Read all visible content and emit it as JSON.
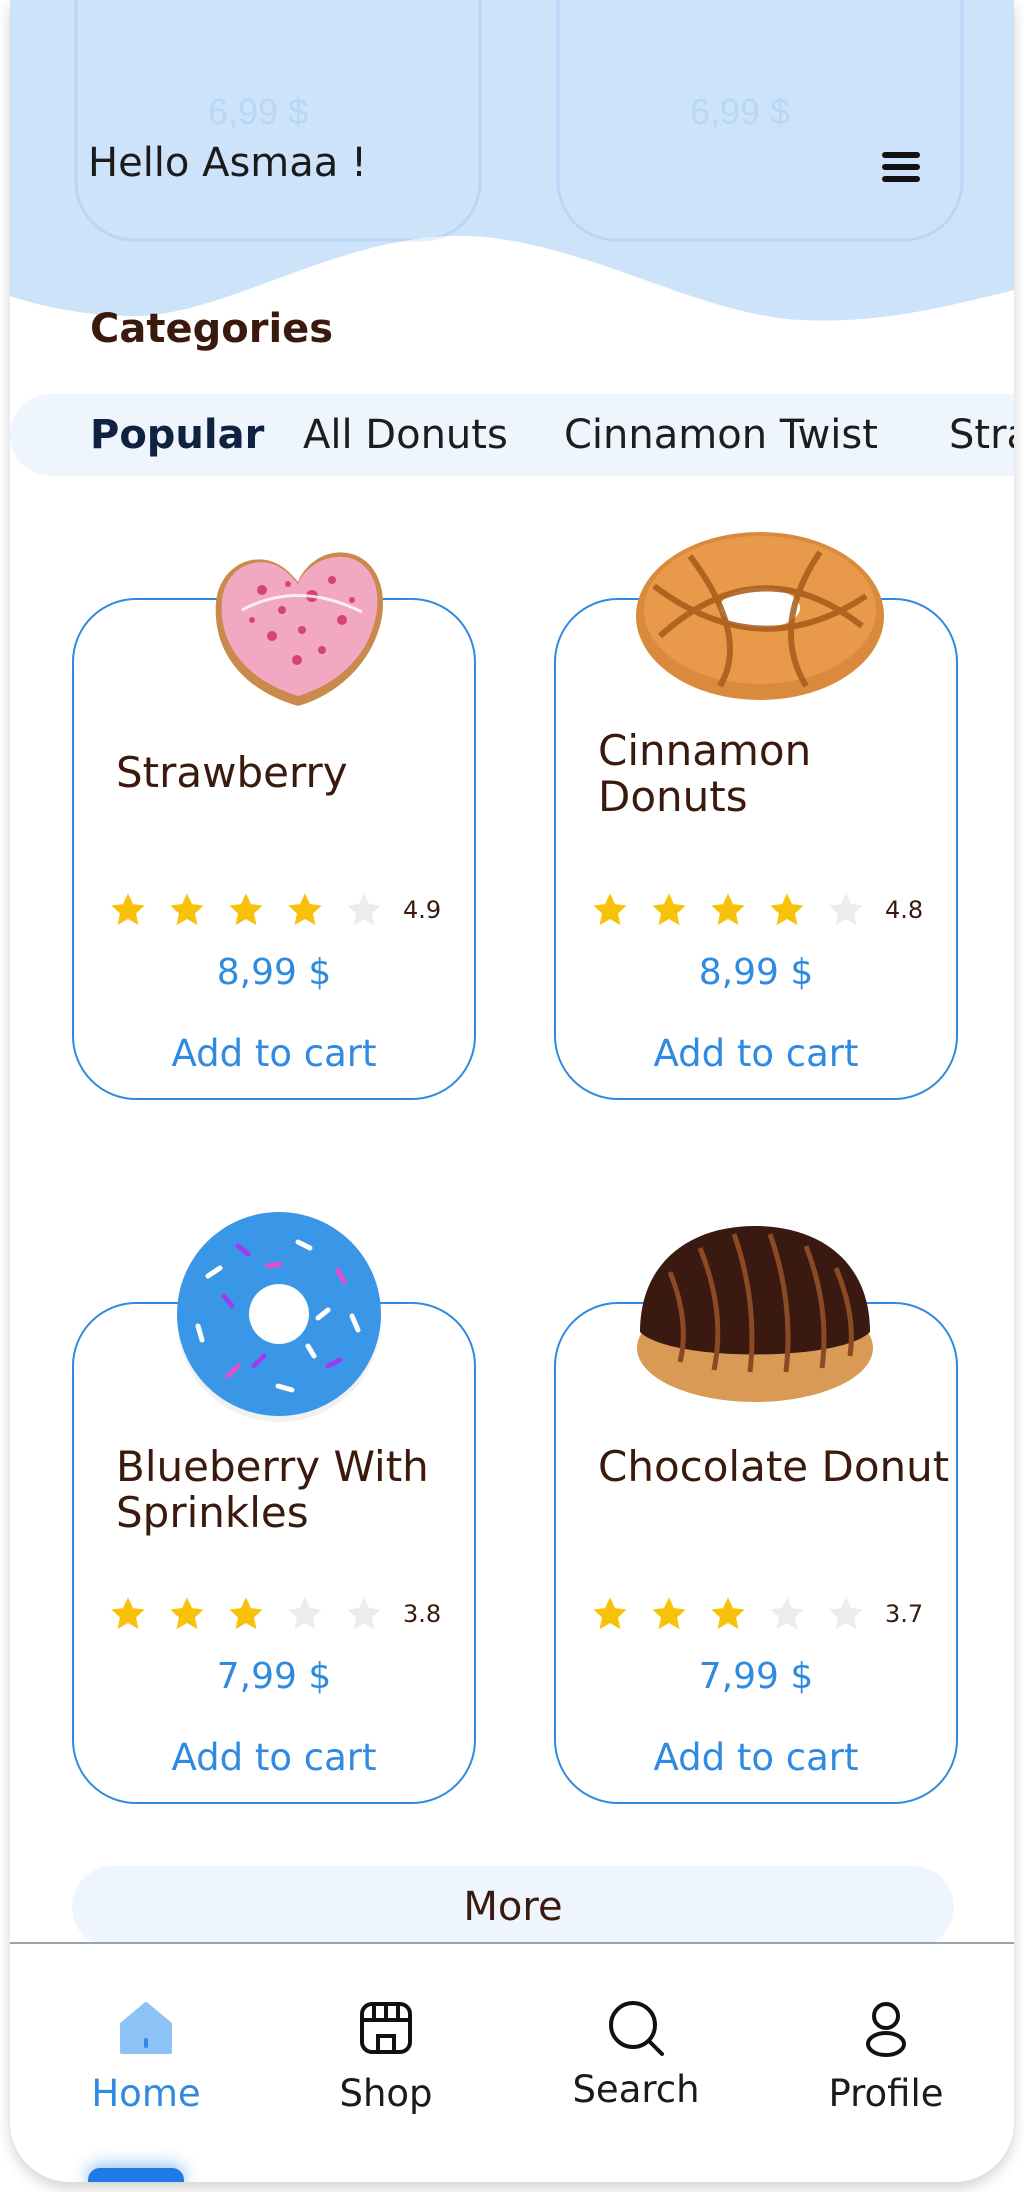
{
  "header": {
    "greeting": "Hello Asmaa !",
    "menu_icon": "hamburger-menu-icon",
    "background_color": "#cde3fa"
  },
  "categories": {
    "title": "Categories",
    "tabs": [
      {
        "label": "Popular",
        "active": true
      },
      {
        "label": "All Donuts",
        "active": false
      },
      {
        "label": "Cinnamon Twist",
        "active": false
      },
      {
        "label": "Strawberry",
        "active": false
      }
    ]
  },
  "products": [
    {
      "name": "Strawberry",
      "rating": "4.9",
      "stars_filled": 4,
      "price": "8,99 $",
      "cta": "Add to cart",
      "image": "pink-heart-donut-image"
    },
    {
      "name": "Cinnamon Donuts",
      "rating": "4.8",
      "stars_filled": 4,
      "price": "8,99 $",
      "cta": "Add to cart",
      "image": "cinnamon-glazed-donut-image"
    },
    {
      "name": "Blueberry With Sprinkles",
      "rating": "3.8",
      "stars_filled": 3,
      "price": "7,99 $",
      "cta": "Add to cart",
      "image": "blue-sprinkle-donut-image"
    },
    {
      "name": "Chocolate Donut",
      "rating": "3.7",
      "stars_filled": 3,
      "price": "7,99 $",
      "cta": "Add to cart",
      "image": "chocolate-drizzle-donut-image"
    }
  ],
  "more_button": "More",
  "bottom_nav": [
    {
      "label": "Home",
      "icon": "home-icon",
      "active": true
    },
    {
      "label": "Shop",
      "icon": "shop-icon",
      "active": false
    },
    {
      "label": "Search",
      "icon": "search-icon",
      "active": false
    },
    {
      "label": "Profile",
      "icon": "profile-icon",
      "active": false
    }
  ],
  "colors": {
    "accent": "#2f8ae0",
    "star": "#f9c20a",
    "star_empty": "#ececec",
    "text_brown": "#3b1a0e",
    "tab_bg": "#eef5fd"
  }
}
